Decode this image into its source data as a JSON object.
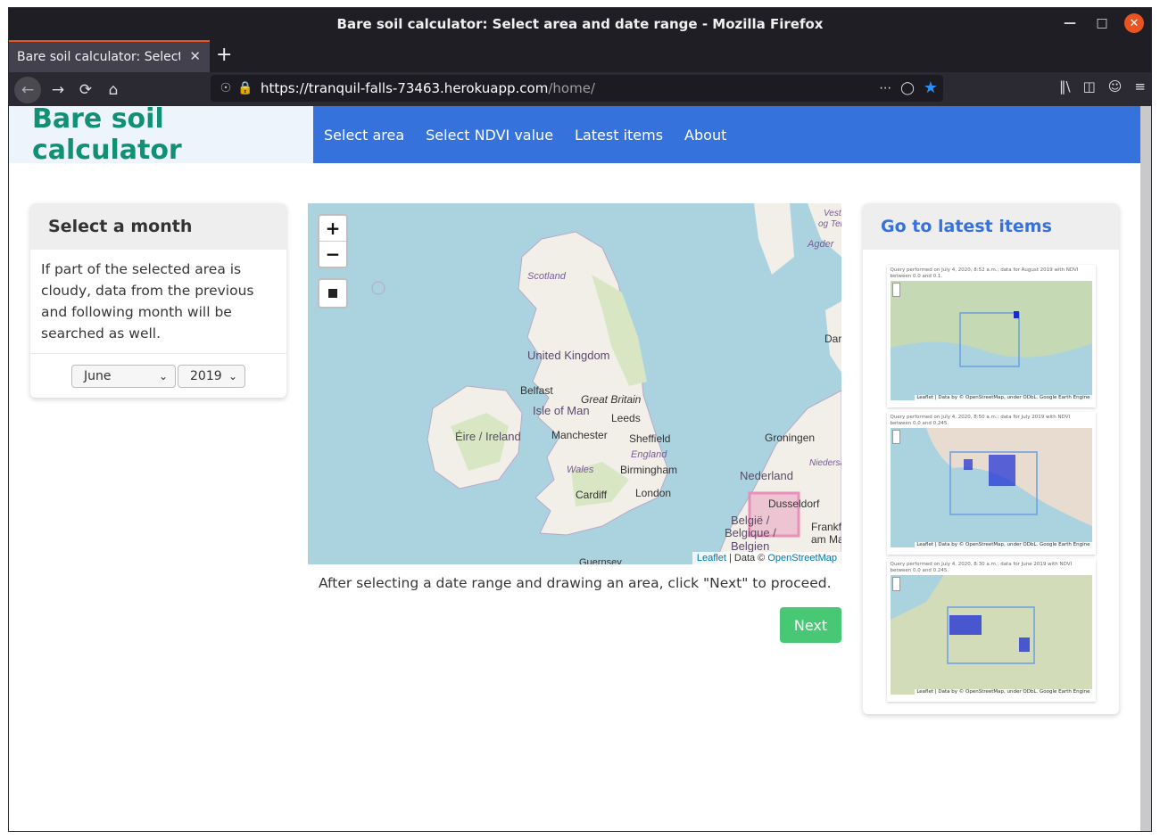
{
  "window": {
    "title": "Bare soil calculator: Select area and date range - Mozilla Firefox"
  },
  "browser": {
    "tab_title": "Bare soil calculator: Select a",
    "url_host": "https://tranquil-falls-73463.herokuapp.com",
    "url_path": "/home/"
  },
  "site": {
    "brand": "Bare soil calculator",
    "menu": [
      "Select area",
      "Select NDVI value",
      "Latest items",
      "About"
    ]
  },
  "month_card": {
    "title": "Select a month",
    "description": "If part of the selected area is cloudy, data from the previous and following month will be searched as well.",
    "month_selected": "June",
    "year_selected": "2019"
  },
  "map": {
    "zoom_in": "+",
    "zoom_out": "−",
    "attribution_leaflet": "Leaflet",
    "attribution_sep": " | Data © ",
    "attribution_osm": "OpenStreetMap",
    "labels": {
      "scotland": "Scotland",
      "united_kingdom": "United Kingdom",
      "belfast": "Belfast",
      "great_britain": "Great Britain",
      "isle_of_man": "Isle of Man",
      "leeds": "Leeds",
      "eire": "Éire / Ireland",
      "manchester": "Manchester",
      "sheffield": "Sheffield",
      "england": "England",
      "wales": "Wales",
      "birmingham": "Birmingham",
      "cardiff": "Cardiff",
      "london": "London",
      "groningen": "Groningen",
      "nederland": "Nederland",
      "dusseldorf": "Dusseldorf",
      "belgie": "België /",
      "belgique": "Belgique /",
      "belgien": "Belgien",
      "frankfurt": "Frankfu",
      "am_main": "am Ma",
      "agder": "Agder",
      "vest": "Vest",
      "og_tele": "og Tele",
      "dar": "Dar",
      "niedersa": "Niedersa",
      "guernsey": "Guernsey"
    }
  },
  "help_text": "After selecting a date range and drawing an area, click \"Next\" to proceed.",
  "next_label": "Next",
  "latest_card": {
    "title": "Go to latest items",
    "thumbnails": [
      {
        "caption": "Query performed on July 4, 2020, 8:52 a.m.; data for August 2019 with NDVI between 0.0 and 0.1.",
        "attribution": "Leaflet | Data by © OpenStreetMap, under ODbL. Google Earth Engine"
      },
      {
        "caption": "Query performed on July 4, 2020, 8:50 a.m.; data for July 2019 with NDVI between 0.0 and 0.245.",
        "attribution": "Leaflet | Data by © OpenStreetMap, under ODbL. Google Earth Engine"
      },
      {
        "caption": "Query performed on July 4, 2020, 8:30 a.m.; data for June 2019 with NDVI between 0.0 and 0.245.",
        "attribution": "Leaflet | Data by © OpenStreetMap, under ODbL. Google Earth Engine"
      }
    ]
  },
  "colors": {
    "brand": "#129076",
    "nav_blue": "#3572dc",
    "next_green": "#48c774",
    "map_water": "#aad3df",
    "map_land": "#f2efe9"
  }
}
